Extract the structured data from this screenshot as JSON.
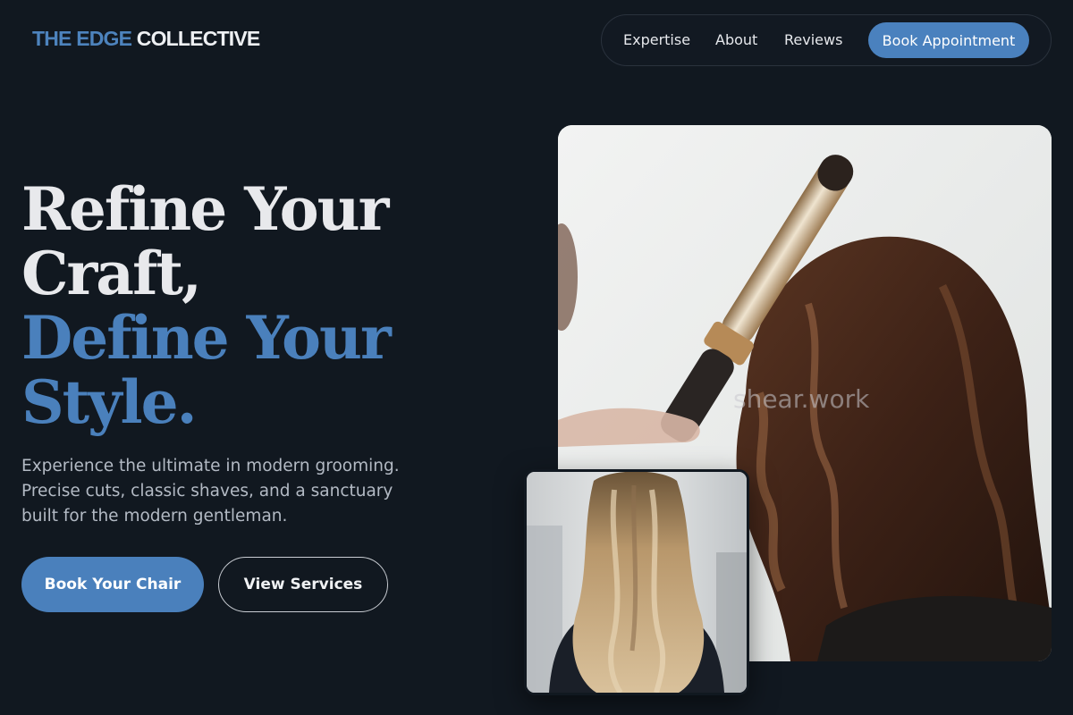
{
  "brand": {
    "name_accent": "THE EDGE",
    "name_rest": "COLLECTIVE",
    "accent_color": "#4a80bc"
  },
  "nav": {
    "links": [
      "Expertise",
      "About",
      "Reviews"
    ],
    "cta": "Book Appointment"
  },
  "hero": {
    "line1": "Refine Your",
    "line2": "Craft,",
    "line3": "Define Your",
    "line4": "Style.",
    "subtext": "Experience the ultimate in modern grooming. Precise cuts, classic shaves, and a sanctuary built for the modern gentleman.",
    "primary_button": "Book Your Chair",
    "secondary_button": "View Services"
  },
  "images": {
    "main_watermark": "shear.work"
  }
}
